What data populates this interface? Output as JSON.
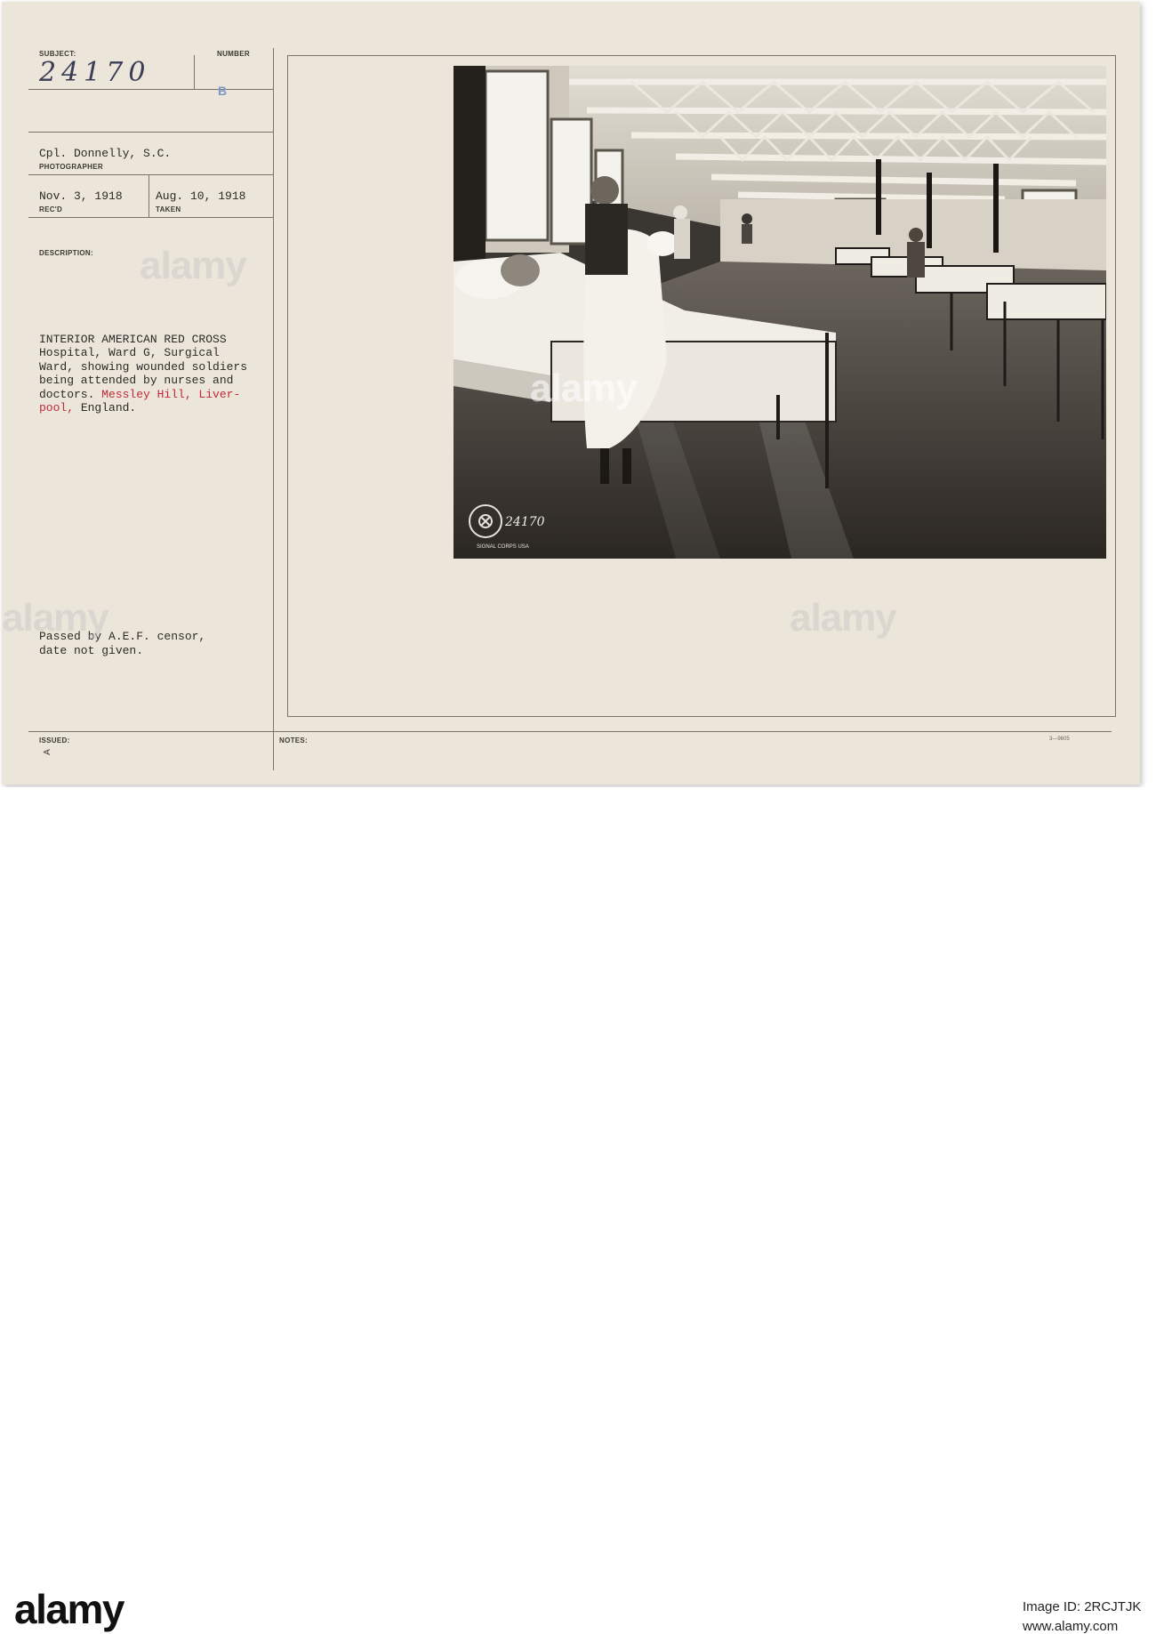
{
  "record": {
    "subject_label": "SUBJECT:",
    "number_label": "NUMBER",
    "subject_handwritten": "24170",
    "number_stamp": "B",
    "photographer_value": "Cpl. Donnelly, S.C.",
    "photographer_label": "PHOTOGRAPHER",
    "received_value": "Nov. 3, 1918",
    "received_label": "REC'D",
    "taken_value": "Aug. 10, 1918",
    "taken_label": "TAKEN",
    "description_label": "DESCRIPTION:",
    "description_lines": [
      "INTERIOR AMERICAN RED CROSS",
      "Hospital, Ward G, Surgical",
      "Ward, showing wounded soldiers",
      "being attended by nurses and"
    ],
    "description_line5_black": "doctors. ",
    "description_line5_red": "Messley Hill, Liver-",
    "description_line6_red": "pool,",
    "description_line6_black": " England.",
    "censor_line1": "Passed by A.E.F. censor,",
    "censor_line2": "date not given.",
    "issued_label": "ISSUED:",
    "issued_mark": "A",
    "notes_label": "NOTES:",
    "form_code": "3—9605"
  },
  "photo": {
    "stamp_text": "SIGNAL CORPS USA",
    "stamp_number": "24170"
  },
  "watermark": {
    "text": "alamy"
  },
  "footer": {
    "logo": "alamy",
    "image_id": "Image ID: 2RCJTJK",
    "site": "www.alamy.com"
  },
  "colors": {
    "card": "#ece6da",
    "red_type": "#c0283a",
    "stamp_blue": "#7d98c9"
  }
}
